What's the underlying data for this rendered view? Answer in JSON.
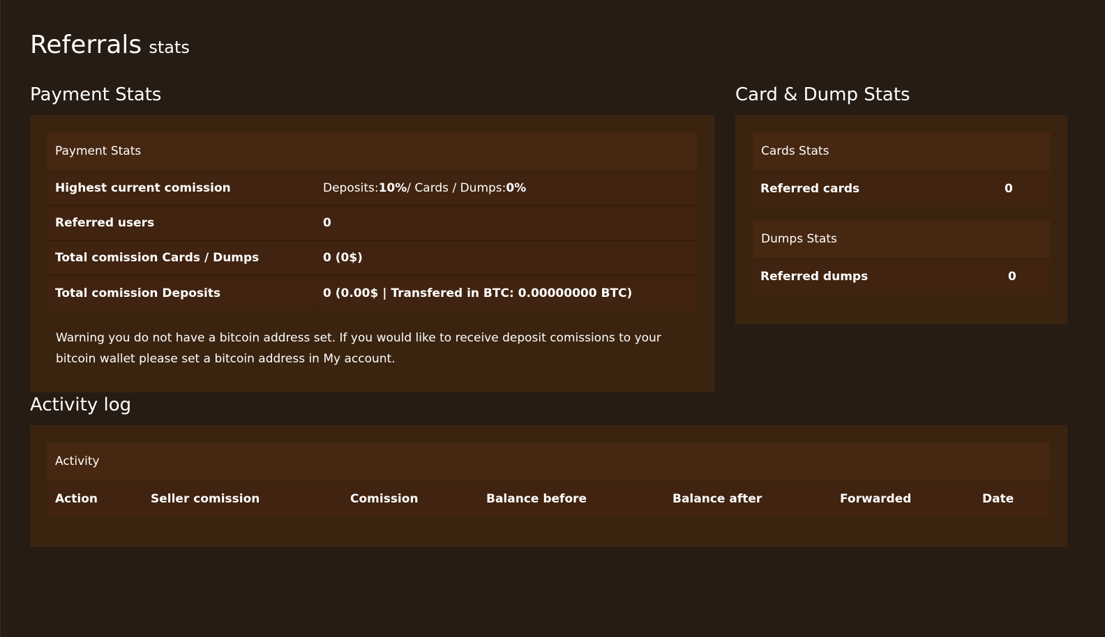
{
  "header": {
    "title": "Referrals",
    "subtitle": "stats"
  },
  "payment_stats": {
    "section_title": "Payment Stats",
    "box_title": "Payment Stats",
    "rows": [
      {
        "label": "Highest current comission",
        "value_prefix": "Deposits: ",
        "value_bold1": "10%",
        "value_mid": " / Cards / Dumps: ",
        "value_bold2": "0%"
      },
      {
        "label": "Referred users",
        "value": "0"
      },
      {
        "label": "Total comission Cards / Dumps",
        "value": "0 (0$)"
      },
      {
        "label": "Total comission Deposits",
        "value": "0 (0.00$ | Transfered in BTC: 0.00000000 BTC)"
      }
    ],
    "warning": "Warning you do not have a bitcoin address set. If you would like to receive deposit comissions to your bitcoin wallet please set a bitcoin address in My account."
  },
  "card_dump_stats": {
    "section_title": "Card & Dump Stats",
    "cards": {
      "box_title": "Cards Stats",
      "label": "Referred cards",
      "value": "0"
    },
    "dumps": {
      "box_title": "Dumps Stats",
      "label": "Referred dumps",
      "value": "0"
    }
  },
  "activity_log": {
    "section_title": "Activity log",
    "box_title": "Activity",
    "columns": [
      "Action",
      "Seller comission",
      "Comission",
      "Balance before",
      "Balance after",
      "Forwarded",
      "Date"
    ]
  },
  "colors": {
    "background": "#261c14",
    "panel": "#3a2410",
    "box_header": "#462711",
    "row": "#402310",
    "text": "#ffffff"
  }
}
